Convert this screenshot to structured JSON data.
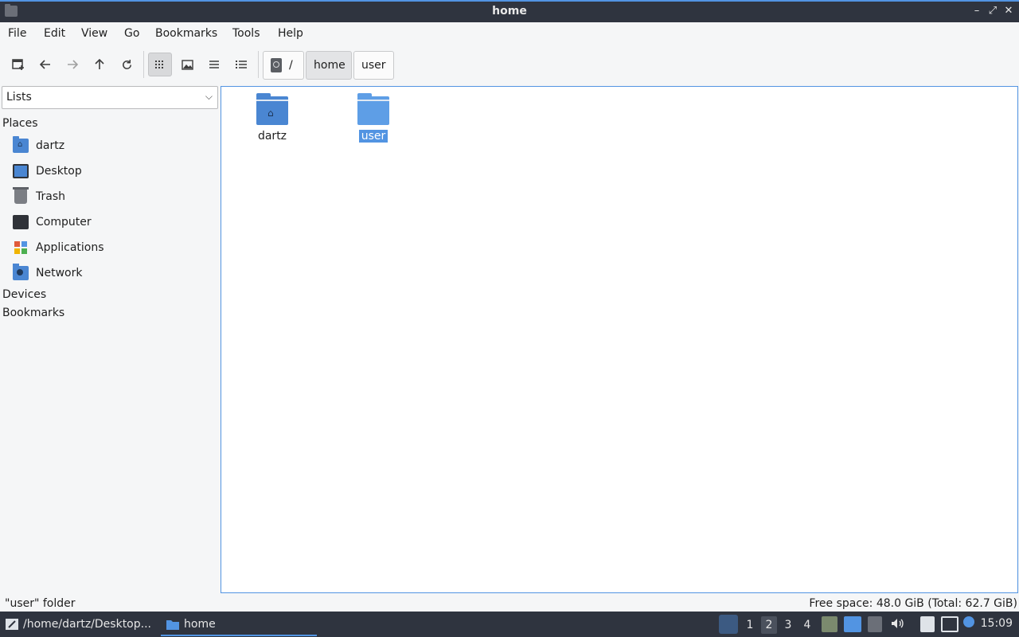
{
  "window": {
    "title": "home"
  },
  "menubar": {
    "items": [
      "File",
      "Edit",
      "View",
      "Go",
      "Bookmarks",
      "Tools",
      "Help"
    ]
  },
  "path": {
    "root_label": "/",
    "segments": [
      "home",
      "user"
    ],
    "current": "home"
  },
  "sidebar": {
    "selector": "Lists",
    "sections": {
      "places": "Places",
      "devices": "Devices",
      "bookmarks": "Bookmarks"
    },
    "places": [
      {
        "label": "dartz",
        "icon": "home-folder-icon"
      },
      {
        "label": "Desktop",
        "icon": "desktop-icon"
      },
      {
        "label": "Trash",
        "icon": "trash-icon"
      },
      {
        "label": "Computer",
        "icon": "computer-icon"
      },
      {
        "label": "Applications",
        "icon": "applications-icon"
      },
      {
        "label": "Network",
        "icon": "network-icon"
      }
    ]
  },
  "files": [
    {
      "name": "dartz",
      "icon": "home-folder-icon",
      "selected": false
    },
    {
      "name": "user",
      "icon": "folder-icon",
      "selected": true
    }
  ],
  "status": {
    "selection": "\"user\" folder",
    "free_space": "Free space: 48.0 GiB (Total: 62.7 GiB)"
  },
  "taskbar": {
    "tasks": [
      "/home/dartz/Desktop...",
      "home"
    ],
    "workspaces": [
      "1",
      "2",
      "3",
      "4"
    ],
    "current_workspace": "2",
    "clock": "15:09"
  },
  "colors": {
    "accent": "#5294e2",
    "folder": "#4a86d2",
    "titlebar": "#2f343f"
  }
}
